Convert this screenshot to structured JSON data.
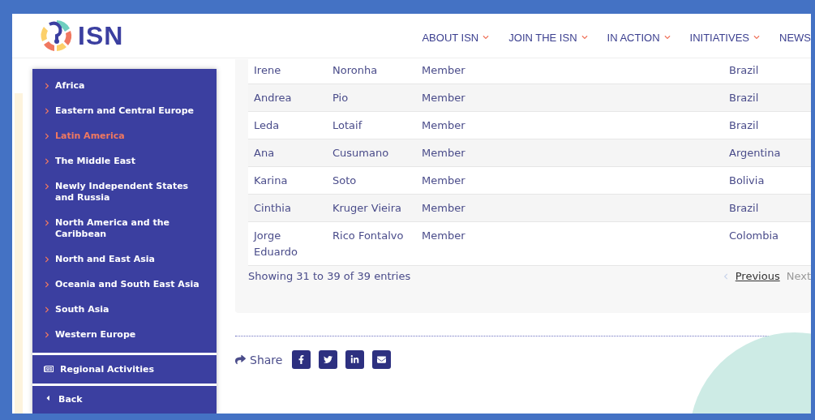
{
  "logo": {
    "text": "ISN"
  },
  "nav": [
    {
      "label": "ABOUT ISN",
      "dropdown": true
    },
    {
      "label": "JOIN THE ISN",
      "dropdown": true
    },
    {
      "label": "IN ACTION",
      "dropdown": true
    },
    {
      "label": "INITIATIVES",
      "dropdown": true
    },
    {
      "label": "NEWS",
      "dropdown": false
    }
  ],
  "sidebar": {
    "items": [
      {
        "label": "Africa",
        "selected": false
      },
      {
        "label": "Eastern and Central Europe",
        "selected": false
      },
      {
        "label": "Latin America",
        "selected": true
      },
      {
        "label": "The Middle East",
        "selected": false
      },
      {
        "label": "Newly Independent States and Russia",
        "selected": false
      },
      {
        "label": "North America and the Caribbean",
        "selected": false
      },
      {
        "label": "North and East Asia",
        "selected": false
      },
      {
        "label": "Oceania and South East Asia",
        "selected": false
      },
      {
        "label": "South Asia",
        "selected": false
      },
      {
        "label": "Western Europe",
        "selected": false
      }
    ],
    "regional": "Regional Activities",
    "back": "Back"
  },
  "table": {
    "rows": [
      {
        "first": "Irene",
        "last": "Noronha",
        "role": "Member",
        "country": "Brazil"
      },
      {
        "first": "Andrea",
        "last": "Pio",
        "role": "Member",
        "country": "Brazil"
      },
      {
        "first": "Leda",
        "last": "Lotaif",
        "role": "Member",
        "country": "Brazil"
      },
      {
        "first": "Ana",
        "last": "Cusumano",
        "role": "Member",
        "country": "Argentina"
      },
      {
        "first": "Karina",
        "last": "Soto",
        "role": "Member",
        "country": "Bolivia"
      },
      {
        "first": "Cinthia",
        "last": "Kruger Vieira",
        "role": "Member",
        "country": "Brazil"
      },
      {
        "first": "Jorge Eduardo",
        "last": "Rico Fontalvo",
        "role": "Member",
        "country": "Colombia"
      }
    ],
    "info": "Showing 31 to 39 of 39 entries",
    "pagination": [
      {
        "label": "Previous",
        "disabled": false
      },
      {
        "label": "Next",
        "disabled": true
      }
    ]
  },
  "share": {
    "label": "Share",
    "buttons": [
      {
        "kind": "facebook"
      },
      {
        "kind": "twitter"
      },
      {
        "kind": "linkedin"
      },
      {
        "kind": "email"
      }
    ]
  }
}
